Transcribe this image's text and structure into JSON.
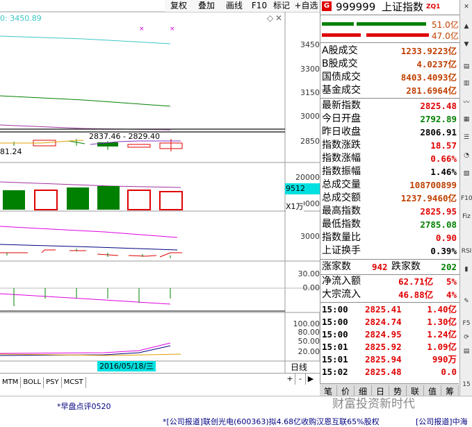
{
  "toolbar": {
    "items": [
      "复权",
      "叠加",
      "画线",
      "F10",
      "标记",
      "+自选"
    ]
  },
  "chart": {
    "ma_readout": "0: 3450.89",
    "price_axis": [
      "3450",
      "3300",
      "3150",
      "3000",
      "2850"
    ],
    "range_annotation": "2837.46 - 2829.40",
    "left_price": "81.24",
    "volume_axis": [
      "20000",
      "10000"
    ],
    "volume_highlight": "9512",
    "volume_unit": "X1万",
    "macd_axis": [
      "3000"
    ],
    "indicator_axis": [
      "30.00",
      "0.00"
    ],
    "osc_axis": [
      "100.00",
      "80.00",
      "50.00",
      "20.00"
    ],
    "date_label": "2016/05/18/三",
    "period_label": "日线",
    "sub_tabs": [
      "MTM",
      "BOLL",
      "PSY",
      "MCST"
    ],
    "plus": "+",
    "minus": "-",
    "right_arrow": "▶"
  },
  "panel": {
    "badge": "G",
    "code": "999999",
    "name": "上证指数",
    "tag": "ZQ1",
    "bar_values": [
      "51.0亿",
      "47.0亿"
    ],
    "turnover": [
      {
        "label": "A股成交",
        "value": "1233.9223亿"
      },
      {
        "label": "B股成交",
        "value": "4.0237亿"
      },
      {
        "label": "国债成交",
        "value": "8403.4093亿"
      },
      {
        "label": "基金成交",
        "value": "281.6964亿"
      }
    ],
    "stats": [
      {
        "label": "最新指数",
        "value": "2825.48",
        "color": "red"
      },
      {
        "label": "今日开盘",
        "value": "2792.89",
        "color": "grn"
      },
      {
        "label": "昨日收盘",
        "value": "2806.91",
        "color": "blk"
      },
      {
        "label": "指数涨跌",
        "value": "18.57",
        "color": "red"
      },
      {
        "label": "指数涨幅",
        "value": "0.66%",
        "color": "red"
      },
      {
        "label": "指数振幅",
        "value": "1.46%",
        "color": "blk"
      },
      {
        "label": "总成交量",
        "value": "108700899",
        "color": "brn"
      },
      {
        "label": "总成交额",
        "value": "1237.9460亿",
        "color": "brn"
      },
      {
        "label": "最高指数",
        "value": "2825.95",
        "color": "red"
      },
      {
        "label": "最低指数",
        "value": "2785.08",
        "color": "grn"
      },
      {
        "label": "指数量比",
        "value": "0.90",
        "color": "red"
      },
      {
        "label": "上证换手",
        "value": "0.39%",
        "color": "blk"
      }
    ],
    "breadth": {
      "up_label": "涨家数",
      "up": "942",
      "down_label": "跌家数",
      "down": "202"
    },
    "flows": [
      {
        "label": "净流入额",
        "value": "62.71亿",
        "pct": "5%"
      },
      {
        "label": "大宗流入",
        "value": "46.88亿",
        "pct": "4%"
      }
    ],
    "ticks": [
      {
        "time": "15:00",
        "price": "2825.41",
        "vol": "1.40亿"
      },
      {
        "time": "15:00",
        "price": "2824.74",
        "vol": "1.30亿"
      },
      {
        "time": "15:00",
        "price": "2824.95",
        "vol": "1.24亿"
      },
      {
        "time": "15:01",
        "price": "2825.92",
        "vol": "1.09亿"
      },
      {
        "time": "15:01",
        "price": "2825.94",
        "vol": "990万"
      },
      {
        "time": "15:02",
        "price": "2825.48",
        "vol": "0.0"
      }
    ],
    "bottom_tabs": [
      "笔",
      "价",
      "细",
      "日",
      "势",
      "联",
      "值",
      "筹"
    ]
  },
  "sidebar": {
    "icons": [
      "close-icon",
      "chevron-up-icon",
      "chevron-down-icon",
      "chart-icon",
      "bars-icon",
      "line-icon",
      "grid-icon",
      "list-icon",
      "pie-icon",
      "table-icon",
      "f10-icon",
      "fiz-icon",
      "rsi-icon",
      "candle-icon",
      "pen-icon",
      "f5-icon",
      "refresh-icon",
      "chart-icon"
    ],
    "labels": [
      "✕",
      "▲",
      "▼",
      "▤",
      "▥",
      "〰",
      "▦",
      "☰",
      "◔",
      "▧",
      "F10",
      "Fiz",
      "RSI",
      "▮",
      "✎",
      "F5",
      "⟳",
      "▤"
    ],
    "num": "15"
  },
  "footer": {
    "news1": "*早盘点评0520",
    "news2": "*[公司报道]联创光电(600363)拟4.68亿收购汉恩互联65%股权",
    "news3": "[公司报道]中海",
    "watermark": "财富投资新时代"
  },
  "colors": {
    "red": "#e00000",
    "green": "#008000",
    "cyan": "#00e0e0",
    "brown": "#c04000"
  }
}
